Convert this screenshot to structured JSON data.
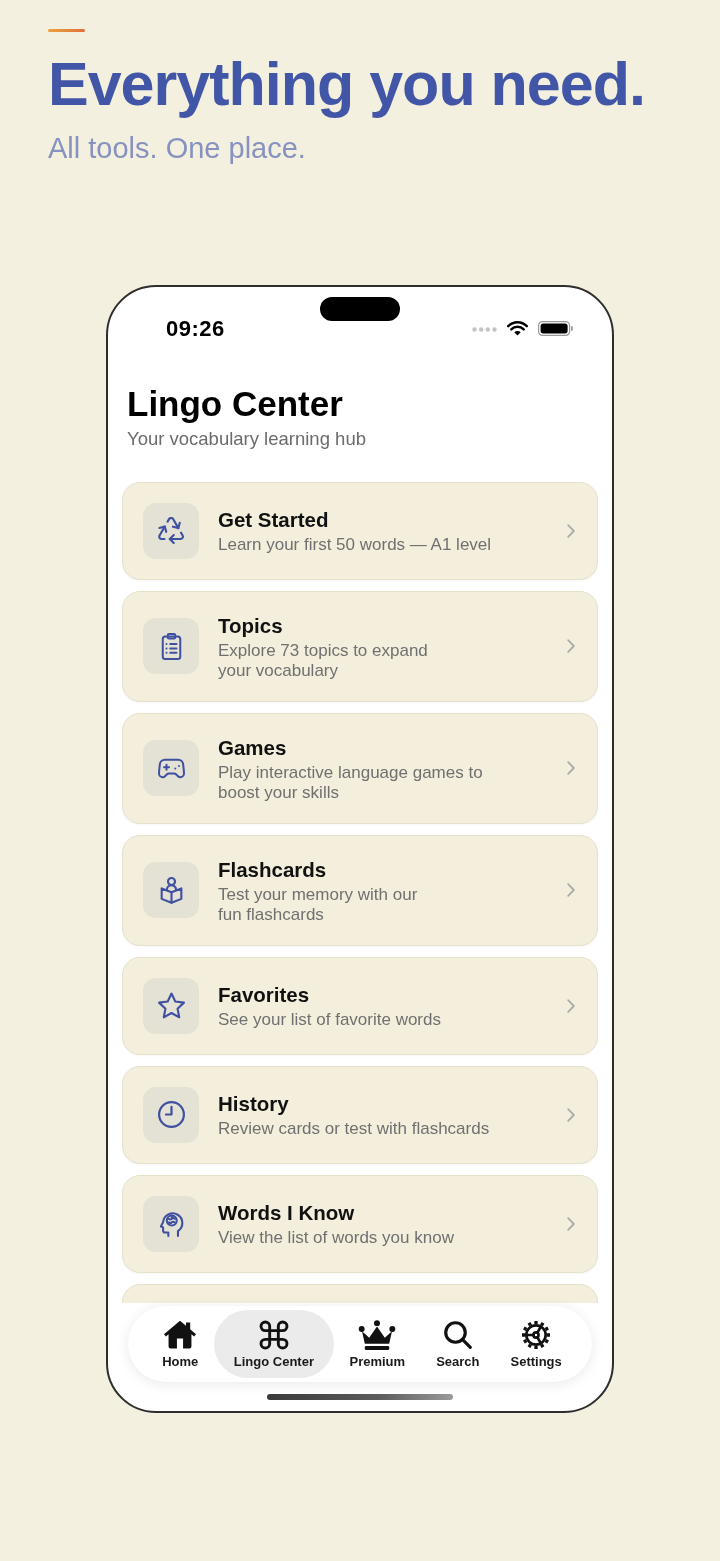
{
  "promo": {
    "headline": "Everything you need.",
    "tagline": "All tools. One place."
  },
  "phone": {
    "status_bar": {
      "time": "09:26"
    },
    "screen": {
      "title": "Lingo Center",
      "subtitle": "Your vocabulary learning hub"
    },
    "menu": {
      "items": [
        {
          "title": "Get Started",
          "description": "Learn your first 50 words — A1 level"
        },
        {
          "title": "Topics",
          "description": "Explore 73 topics to expand\nyour vocabulary"
        },
        {
          "title": "Games",
          "description": "Play interactive language games to\nboost your skills"
        },
        {
          "title": "Flashcards",
          "description": "Test your memory with our\nfun flashcards"
        },
        {
          "title": "Favorites",
          "description": "See your list of favorite words"
        },
        {
          "title": "History",
          "description": "Review cards or test with flashcards"
        },
        {
          "title": "Words I Know",
          "description": "View the list of words you know"
        }
      ],
      "more_below": true
    },
    "tab_bar": {
      "items": [
        {
          "label": "Home",
          "selected": false
        },
        {
          "label": "Lingo Center",
          "selected": true
        },
        {
          "label": "Premium",
          "selected": false
        },
        {
          "label": "Search",
          "selected": false
        },
        {
          "label": "Settings",
          "selected": false
        }
      ]
    }
  }
}
